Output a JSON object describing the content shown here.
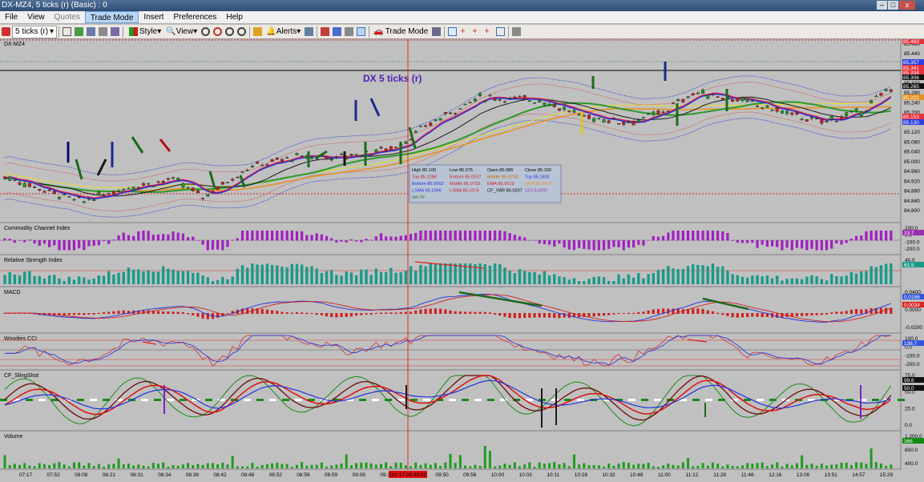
{
  "window": {
    "title": "DX-MZ4, 5 ticks (r) (Basic) : 0"
  },
  "menu": [
    {
      "label": "File",
      "state": "normal"
    },
    {
      "label": "View",
      "state": "normal"
    },
    {
      "label": "Quotes",
      "state": "disabled"
    },
    {
      "label": "Trade Mode",
      "state": "selected"
    },
    {
      "label": "Insert",
      "state": "normal"
    },
    {
      "label": "Preferences",
      "state": "normal"
    },
    {
      "label": "Help",
      "state": "normal"
    }
  ],
  "toolbar": {
    "interval": "5 ticks (r)",
    "style_label": "Style",
    "view_label": "View",
    "alerts_label": "Alerts",
    "trade_mode_label": "Trade Mode"
  },
  "chart": {
    "symbol_label": "DX-MZ4",
    "caption": "DX 5 ticks (r)",
    "price_axis": [
      "85.480",
      "85.440",
      "85.400",
      "85.360",
      "85.320",
      "85.280",
      "85.240",
      "85.200",
      "85.160",
      "85.120",
      "85.080",
      "85.040",
      "85.000",
      "84.960",
      "84.920",
      "84.880",
      "84.840",
      "84.800"
    ],
    "price_tags": [
      {
        "text": "85.493",
        "color": "#e8303a"
      },
      {
        "text": "85.357",
        "color": "#2d3ee0"
      },
      {
        "text": "85.341",
        "color": "#e8303a"
      },
      {
        "text": "85.334",
        "color": "#e8303a"
      },
      {
        "text": "85.306",
        "color": "#101010"
      },
      {
        "text": "85.265",
        "color": "#101010"
      },
      {
        "text": "85.221",
        "color": "#e89020"
      },
      {
        "text": "85.153",
        "color": "#e8303a"
      },
      {
        "text": "85.130",
        "color": "#2d3ee0"
      }
    ],
    "data_window": {
      "row1": [
        [
          "High",
          "85.100"
        ],
        [
          "Low",
          "85.075"
        ],
        [
          "Open",
          "85.085"
        ],
        [
          "Close",
          "85.100"
        ]
      ],
      "row2": [
        [
          "Top",
          "85.1268"
        ],
        [
          "Bottom",
          "85.0197"
        ],
        [
          "Middle",
          "85.0733"
        ],
        [
          "Top",
          "85.1402"
        ]
      ],
      "row3": [
        [
          "Bottom",
          "85.0063"
        ],
        [
          "Middle",
          "85.0733"
        ],
        [
          "EMA",
          "85.0619"
        ],
        [
          "SMA",
          "85.0424"
        ]
      ],
      "row4": [
        [
          "LSMA",
          "85.1066"
        ],
        [
          "LSMA",
          "85.1074"
        ],
        [
          "CF_YBR",
          "85.0207"
        ],
        [
          "CCI",
          "0.0297"
        ]
      ],
      "row5": [
        [
          "Vol",
          "70"
        ]
      ]
    },
    "cursor_time": "Oct 17 09:40:02",
    "time_axis": [
      "07:17",
      "07:52",
      "08:08",
      "08:21",
      "08:31",
      "08:34",
      "08:39",
      "08:42",
      "08:48",
      "08:52",
      "08:56",
      "08:59",
      "09:09",
      "09:18",
      "09:40",
      "09:50",
      "09:56",
      "10:00",
      "10:03",
      "10:11",
      "10:28",
      "10:32",
      "10:49",
      "11:00",
      "11:12",
      "11:28",
      "11:46",
      "12:16",
      "13:06",
      "13:51",
      "14:57",
      "15:29"
    ]
  },
  "indicators": [
    {
      "name": "Commodity Channel Index",
      "axis": [
        "200.0",
        "0.0",
        "-100.0",
        "-200.0"
      ],
      "tag": "23.7",
      "tag_color": "#9a2fb0"
    },
    {
      "name": "Relative Strength Index",
      "axis": [
        "40.0"
      ],
      "tag": "61.5",
      "tag_color": "#1a9a8a"
    },
    {
      "name": "MACD",
      "axis": [
        "0.0400",
        "0.0000",
        "-0.0200"
      ],
      "tag": "0.0186",
      "tag_color": "#3355dd",
      "tag2": "0.0034",
      "tag2_color": "#dd2222"
    },
    {
      "name": "Woodies CCI",
      "axis": [
        "100.0",
        "0.0",
        "-100.0",
        "-200.0"
      ],
      "tag": "138.7",
      "tag_color": "#3355dd"
    },
    {
      "name": "CF_SlingShot",
      "axis": [
        "75.0",
        "50.0",
        "25.0",
        "0.0"
      ],
      "tag": "99.6",
      "tag_color": "#101010",
      "tag2": "50.0",
      "tag2_color": "#101010"
    },
    {
      "name": "Volume",
      "axis": [
        "1,200.0",
        "800.0",
        "400.0"
      ],
      "tag": "366",
      "tag_color": "#108a10"
    }
  ],
  "colors": {
    "background": "#c0c0c0",
    "up_candle": "#1e9c1e",
    "down_candle": "#c81e1e",
    "cursor": "#e01010"
  }
}
